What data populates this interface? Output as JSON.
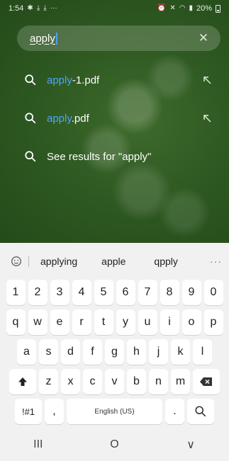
{
  "status": {
    "time": "1:54",
    "icons_left": [
      "notification-icon",
      "download-icon",
      "download-icon",
      "more-icon"
    ],
    "battery": "20%"
  },
  "search": {
    "value": "apply"
  },
  "results": [
    {
      "highlight": "apply",
      "rest": "-1.pdf"
    },
    {
      "highlight": "apply",
      "rest": ".pdf"
    }
  ],
  "see_results": "See results for \"apply\"",
  "keyboard": {
    "suggestions": [
      "applying",
      "apple",
      "qpply"
    ],
    "more": "···",
    "number_row": [
      "1",
      "2",
      "3",
      "4",
      "5",
      "6",
      "7",
      "8",
      "9",
      "0"
    ],
    "row1": [
      "q",
      "w",
      "e",
      "r",
      "t",
      "y",
      "u",
      "i",
      "o",
      "p"
    ],
    "row2": [
      "a",
      "s",
      "d",
      "f",
      "g",
      "h",
      "j",
      "k",
      "l"
    ],
    "row3": [
      "z",
      "x",
      "c",
      "v",
      "b",
      "n",
      "m"
    ],
    "sym_label": "!#1",
    "comma": ",",
    "space_label": "English (US)",
    "period": "."
  },
  "nav": {
    "recents": "III",
    "home": "O",
    "back": "∨"
  }
}
